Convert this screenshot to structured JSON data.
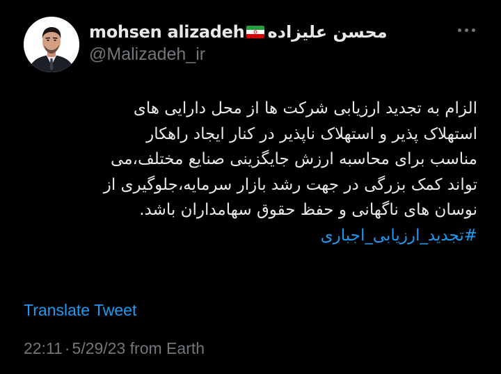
{
  "author": {
    "display_name": "mohsen alizadeh",
    "display_name_fa": "محسن علیزاده",
    "flag": "iran-flag",
    "handle": "@Malizadeh_ir",
    "avatar": "avatar-photo"
  },
  "more_icon": "more-horizontal-icon",
  "tweet": {
    "lines": [
      "الزام به تجدید ارزیابی شرکت ها از محل دارایی های",
      "استهلاک پذیر و استهلاک ناپذیر در کنار ایجاد راهکار",
      "مناسب برای محاسبه ارزش جایگزینی صنایع مختلف،می",
      "تواند کمک بزرگی در جهت رشد بازار سرمایه،جلوگیری از",
      "نوسان های ناگهانی و حفظ حقوق سهامداران باشد."
    ],
    "hashtag": "#تجدید_ارزیابی_اجباری"
  },
  "translate_label": "Translate Tweet",
  "meta": {
    "time": "22:11",
    "separator": "·",
    "date": "5/29/23",
    "source": "from Earth"
  },
  "colors": {
    "background": "#000000",
    "text": "#e7e9ea",
    "secondary": "#71767b",
    "accent": "#1d9bf0"
  }
}
